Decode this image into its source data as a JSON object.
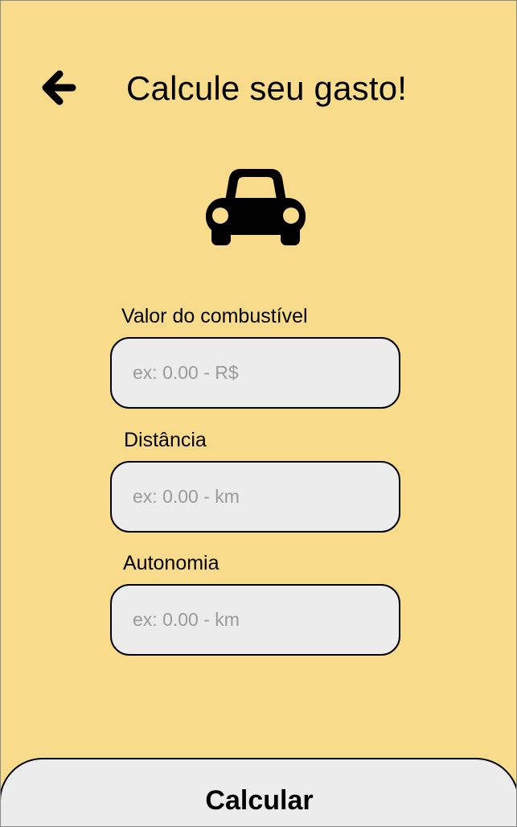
{
  "header": {
    "back_icon": "arrow-left-icon",
    "title": "Calcule seu gasto!"
  },
  "hero": {
    "icon": "car-icon"
  },
  "form": {
    "fuel_price": {
      "label": "Valor do combustível",
      "placeholder": "ex: 0.00 - R$",
      "value": ""
    },
    "distance": {
      "label": "Distância",
      "placeholder": "ex: 0.00 - km",
      "value": ""
    },
    "autonomy": {
      "label": "Autonomia",
      "placeholder": "ex: 0.00 - km",
      "value": ""
    }
  },
  "actions": {
    "calculate_label": "Calcular"
  },
  "colors": {
    "background": "#f8dc8c",
    "input_background": "#ececec",
    "placeholder": "#9a9a9a",
    "text": "#000000"
  }
}
